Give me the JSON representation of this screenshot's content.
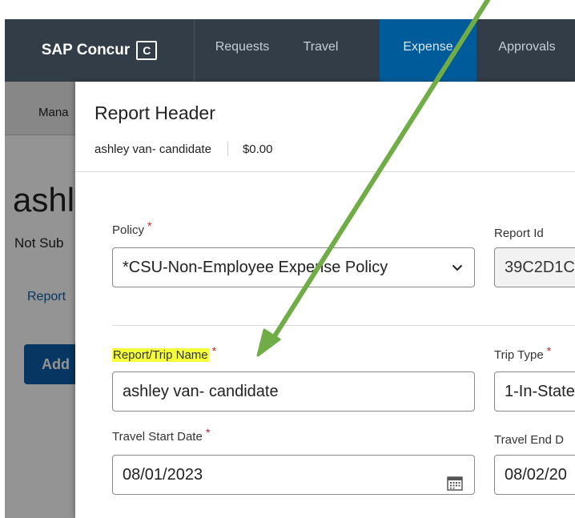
{
  "nav": {
    "brand": "SAP Concur",
    "brand_logo_glyph": "C",
    "items": [
      {
        "label": "Requests",
        "active": false
      },
      {
        "label": "Travel",
        "active": false
      },
      {
        "label": "Expense",
        "active": true
      },
      {
        "label": "Approvals",
        "active": false
      }
    ]
  },
  "background": {
    "subnav_item": "Mana",
    "title": "ashl",
    "status": "Not Sub",
    "link": "Report",
    "button": "Add"
  },
  "modal": {
    "title": "Report Header",
    "report_name": "ashley van- candidate",
    "amount": "$0.00",
    "required_marker": "*",
    "policy": {
      "label": "Policy",
      "value": "*CSU-Non-Employee Expense Policy"
    },
    "report_id": {
      "label": "Report Id",
      "value": "39C2D1C"
    },
    "trip_name": {
      "label": "Report/Trip Name",
      "value": "ashley van- candidate",
      "highlighted": true
    },
    "trip_type": {
      "label": "Trip Type",
      "value": "1-In-State"
    },
    "start_date": {
      "label": "Travel Start Date",
      "value": "08/01/2023"
    },
    "end_date": {
      "label": "Travel End D",
      "value": "08/02/20"
    }
  },
  "icons": {
    "chevron": "chevron-down-icon",
    "calendar": "calendar-icon",
    "arrow": "arrow-annotation"
  },
  "colors": {
    "nav_bg": "#333d47",
    "nav_active": "#005b9a",
    "required": "#d12121",
    "highlight": "#f5ff3a",
    "arrow": "#70ad47"
  }
}
